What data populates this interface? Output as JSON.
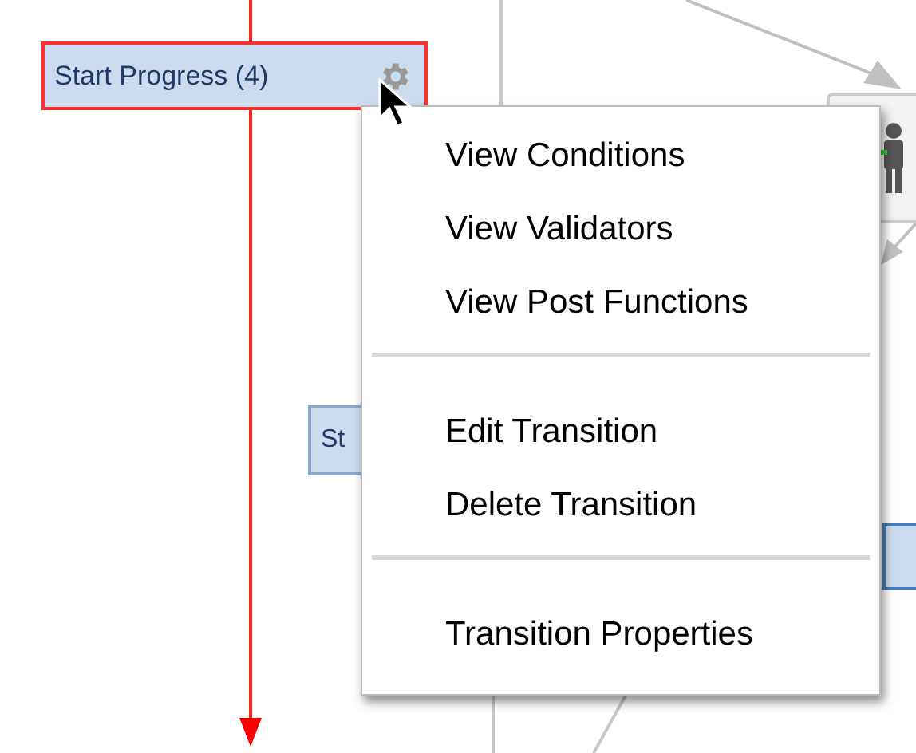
{
  "transition": {
    "label": "Start Progress (4)",
    "selected": true
  },
  "partial_status": {
    "label": "St"
  },
  "context_menu": {
    "groups": [
      {
        "items": [
          "View Conditions",
          "View Validators",
          "View Post Functions"
        ]
      },
      {
        "items": [
          "Edit Transition",
          "Delete Transition"
        ]
      },
      {
        "items": [
          "Transition Properties"
        ]
      }
    ]
  }
}
